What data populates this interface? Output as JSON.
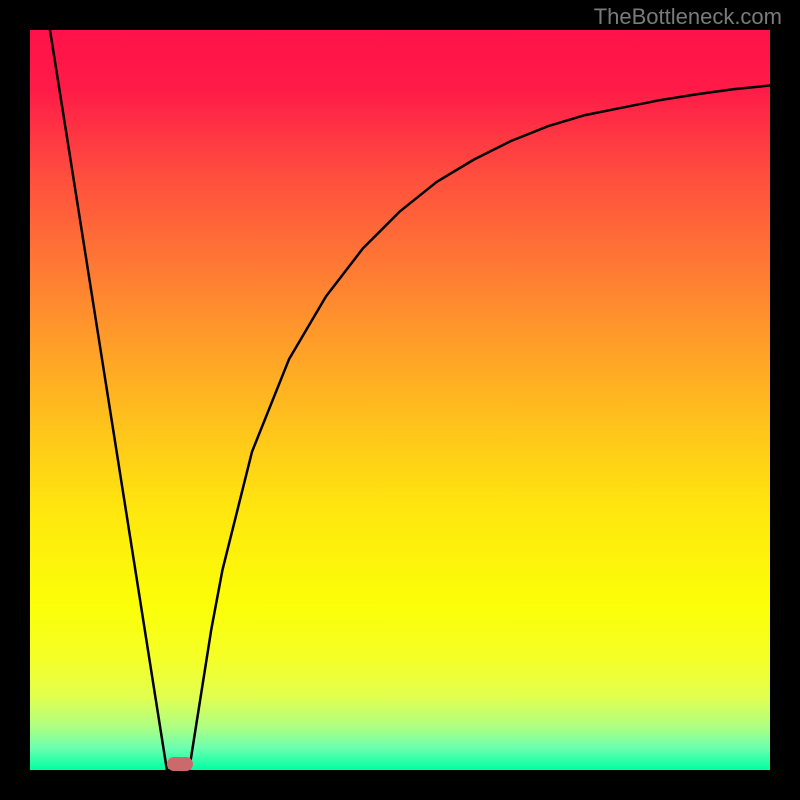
{
  "watermark": "TheBottleneck.com",
  "chart_data": {
    "type": "line",
    "title": "",
    "xlabel": "",
    "ylabel": "",
    "xlim": [
      0,
      1
    ],
    "ylim": [
      0,
      1
    ],
    "grid": false,
    "legend": false,
    "series": [
      {
        "name": "curve",
        "x": [
          0.027,
          0.05,
          0.08,
          0.11,
          0.14,
          0.17,
          0.185,
          0.2,
          0.215,
          0.23,
          0.245,
          0.26,
          0.3,
          0.35,
          0.4,
          0.45,
          0.5,
          0.55,
          0.6,
          0.65,
          0.7,
          0.75,
          0.8,
          0.85,
          0.9,
          0.95,
          1.0
        ],
        "y": [
          1.0,
          0.855,
          0.665,
          0.475,
          0.285,
          0.095,
          0.0,
          0.0,
          0.0,
          0.095,
          0.19,
          0.27,
          0.43,
          0.555,
          0.64,
          0.705,
          0.755,
          0.795,
          0.825,
          0.85,
          0.87,
          0.885,
          0.895,
          0.905,
          0.913,
          0.92,
          0.925
        ]
      }
    ],
    "marker": {
      "x_start": 0.185,
      "x_end": 0.22,
      "color": "#cb6a6d"
    },
    "gradient_stops": [
      {
        "pos": 0.0,
        "color": "#ff1249"
      },
      {
        "pos": 0.08,
        "color": "#ff1b48"
      },
      {
        "pos": 0.2,
        "color": "#ff4f3e"
      },
      {
        "pos": 0.35,
        "color": "#ff8431"
      },
      {
        "pos": 0.5,
        "color": "#ffb820"
      },
      {
        "pos": 0.65,
        "color": "#ffe70e"
      },
      {
        "pos": 0.78,
        "color": "#fbff08"
      },
      {
        "pos": 0.85,
        "color": "#f5ff28"
      },
      {
        "pos": 0.9,
        "color": "#e2ff4e"
      },
      {
        "pos": 0.94,
        "color": "#b1ff80"
      },
      {
        "pos": 0.97,
        "color": "#6cffaf"
      },
      {
        "pos": 1.0,
        "color": "#00ffa2"
      }
    ]
  }
}
